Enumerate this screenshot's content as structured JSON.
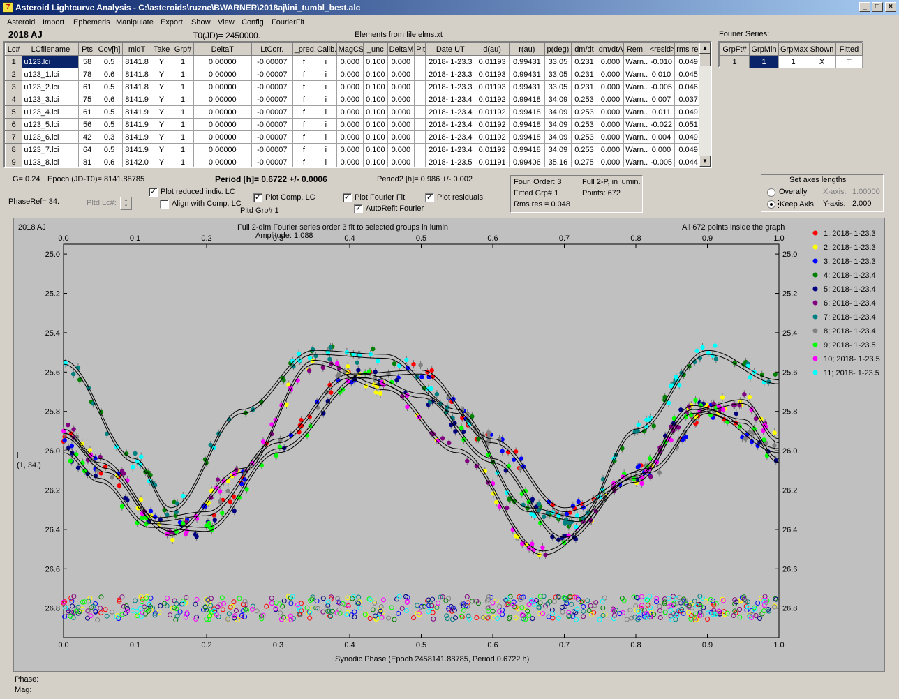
{
  "window": {
    "title": "Asteroid Lightcurve Analysis - C:\\asteroids\\ruzne\\BWARNER\\2018aj\\ini_tumbl_best.alc",
    "icon_name": "app-icon"
  },
  "menu": [
    "Asteroid",
    "Import",
    "Ephemeris",
    "Manipulate",
    "Export",
    "Show",
    "View",
    "Config",
    "FourierFit"
  ],
  "header": {
    "asteroid": "2018 AJ",
    "t0": "T0(JD)= 2450000.",
    "elements": "Elements from file elms.xt",
    "fourier_series_label": "Fourier Series:"
  },
  "lc_table": {
    "columns": [
      "Lc#",
      "LCfilename",
      "Pts",
      "Cov[h]",
      "midT",
      "Take",
      "Grp#",
      "DeltaT",
      "LtCorr.",
      "_pred.",
      "Calib.",
      "MagCS",
      "_unc",
      "DeltaM",
      "Plt",
      "Date UT",
      "d(au)",
      "r(au)",
      "p(deg)",
      "dm/dt",
      "dm/dtA",
      "Rem.",
      "<resid>",
      "rms res"
    ],
    "rows": [
      [
        "1",
        "u123.lci",
        "58",
        "0.5",
        "8141.8",
        "Y",
        "1",
        "0.00000",
        "-0.00007",
        "f",
        "i",
        "0.000",
        "0.100",
        "0.000",
        "",
        "2018- 1-23.3",
        "0.01193",
        "0.99431",
        "33.05",
        "0.231",
        "0.000",
        "Warn...",
        "-0.010",
        "0.049"
      ],
      [
        "2",
        "u123_1.lci",
        "78",
        "0.6",
        "8141.8",
        "Y",
        "1",
        "0.00000",
        "-0.00007",
        "f",
        "i",
        "0.000",
        "0.100",
        "0.000",
        "",
        "2018- 1-23.3",
        "0.01193",
        "0.99431",
        "33.05",
        "0.231",
        "0.000",
        "Warn...",
        "0.010",
        "0.045"
      ],
      [
        "3",
        "u123_2.lci",
        "61",
        "0.5",
        "8141.8",
        "Y",
        "1",
        "0.00000",
        "-0.00007",
        "f",
        "i",
        "0.000",
        "0.100",
        "0.000",
        "",
        "2018- 1-23.3",
        "0.01193",
        "0.99431",
        "33.05",
        "0.231",
        "0.000",
        "Warn...",
        "-0.005",
        "0.046"
      ],
      [
        "4",
        "u123_3.lci",
        "75",
        "0.6",
        "8141.9",
        "Y",
        "1",
        "0.00000",
        "-0.00007",
        "f",
        "i",
        "0.000",
        "0.100",
        "0.000",
        "",
        "2018- 1-23.4",
        "0.01192",
        "0.99418",
        "34.09",
        "0.253",
        "0.000",
        "Warn...",
        "0.007",
        "0.037"
      ],
      [
        "5",
        "u123_4.lci",
        "61",
        "0.5",
        "8141.9",
        "Y",
        "1",
        "0.00000",
        "-0.00007",
        "f",
        "i",
        "0.000",
        "0.100",
        "0.000",
        "",
        "2018- 1-23.4",
        "0.01192",
        "0.99418",
        "34.09",
        "0.253",
        "0.000",
        "Warn...",
        "0.011",
        "0.049"
      ],
      [
        "6",
        "u123_5.lci",
        "56",
        "0.5",
        "8141.9",
        "Y",
        "1",
        "0.00000",
        "-0.00007",
        "f",
        "i",
        "0.000",
        "0.100",
        "0.000",
        "",
        "2018- 1-23.4",
        "0.01192",
        "0.99418",
        "34.09",
        "0.253",
        "0.000",
        "Warn...",
        "-0.022",
        "0.051"
      ],
      [
        "7",
        "u123_6.lci",
        "42",
        "0.3",
        "8141.9",
        "Y",
        "1",
        "0.00000",
        "-0.00007",
        "f",
        "i",
        "0.000",
        "0.100",
        "0.000",
        "",
        "2018- 1-23.4",
        "0.01192",
        "0.99418",
        "34.09",
        "0.253",
        "0.000",
        "Warn...",
        "0.004",
        "0.049"
      ],
      [
        "8",
        "u123_7.lci",
        "64",
        "0.5",
        "8141.9",
        "Y",
        "1",
        "0.00000",
        "-0.00007",
        "f",
        "i",
        "0.000",
        "0.100",
        "0.000",
        "",
        "2018- 1-23.4",
        "0.01192",
        "0.99418",
        "34.09",
        "0.253",
        "0.000",
        "Warn...",
        "0.000",
        "0.049"
      ],
      [
        "9",
        "u123_8.lci",
        "81",
        "0.6",
        "8142.0",
        "Y",
        "1",
        "0.00000",
        "-0.00007",
        "f",
        "i",
        "0.000",
        "0.100",
        "0.000",
        "",
        "2018- 1-23.5",
        "0.01191",
        "0.99406",
        "35.16",
        "0.275",
        "0.000",
        "Warn...",
        "-0.005",
        "0.044"
      ]
    ]
  },
  "fourier_table": {
    "columns": [
      "GrpFt#",
      "GrpMin",
      "GrpMax",
      "Shown",
      "Fitted"
    ],
    "row": [
      "1",
      "1",
      "1",
      "X",
      "T"
    ]
  },
  "info": {
    "g": "G= 0.24",
    "epoch": "Epoch (JD-T0)= 8141.88785",
    "period": "Period [h]= 0.6722 +/- 0.0006",
    "period2": "Period2 [h]= 0.986 +/- 0.002",
    "phaseref": "PhaseRef= 34.",
    "pltd_lc": "Pltd Lc#:",
    "pltd_grp": "Pltd Grp#  1"
  },
  "options": {
    "plot_reduced": "Plot reduced indiv. LC",
    "align": "Align with Comp. LC",
    "plot_comp": "Plot Comp. LC",
    "plot_fourier": "Plot Fourier Fit",
    "plot_residuals": "Plot residuals",
    "autorefit": "AutoRefit Fourier"
  },
  "fitbox": {
    "order": "Four. Order:  3",
    "mode": "Full 2-P, in lumin.",
    "fitted": "Fitted Grp# 1",
    "points": "Points: 672",
    "rms": "Rms res      = 0.048"
  },
  "axes_box": {
    "title": "Set axes lengths",
    "overally": "Overally",
    "keep": "Keep Axis",
    "xaxis_label": "X-axis:",
    "xaxis_value": "1.00000",
    "yaxis_label": "Y-axis:",
    "yaxis_value": "2.000"
  },
  "status": {
    "phase": "Phase:",
    "mag": "Mag:"
  },
  "chart_data": {
    "type": "scatter",
    "corner_label": "2018 AJ",
    "title": "Full 2-dim Fourier series order 3 fit to selected groups in lumin.",
    "subtitle": "Amplitude: 1.088",
    "note": "All 672 points inside the graph",
    "xlabel": "Synodic Phase (Epoch 2458141.88785, Period 0.6722 h)",
    "ylabel": "i",
    "ylabel2": "(1, 34.)",
    "xlim": [
      0.0,
      1.0
    ],
    "ylim": [
      26.95,
      24.95
    ],
    "x_ticks": [
      "0.0",
      "0.1",
      "0.2",
      "0.3",
      "0.4",
      "0.5",
      "0.6",
      "0.7",
      "0.8",
      "0.9",
      "1.0"
    ],
    "y_ticks": [
      "25.0",
      "25.2",
      "25.4",
      "25.6",
      "25.8",
      "26.0",
      "26.2",
      "26.4",
      "26.6",
      "26.8"
    ],
    "residual_baseline": 26.8,
    "series": [
      {
        "name": "1; 2018- 1-23.3",
        "color": "#ff0000",
        "curve": 1
      },
      {
        "name": "2; 2018- 1-23.3",
        "color": "#ffff00",
        "curve": 0
      },
      {
        "name": "3; 2018- 1-23.3",
        "color": "#0000ff",
        "curve": 1
      },
      {
        "name": "4; 2018- 1-23.4",
        "color": "#008000",
        "curve": 2
      },
      {
        "name": "5; 2018- 1-23.4",
        "color": "#000080",
        "curve": 3
      },
      {
        "name": "6; 2018- 1-23.4",
        "color": "#800080",
        "curve": 0
      },
      {
        "name": "7; 2018- 1-23.4",
        "color": "#008080",
        "curve": 2
      },
      {
        "name": "8; 2018- 1-23.4",
        "color": "#808080",
        "curve": 1
      },
      {
        "name": "9; 2018- 1-23.5",
        "color": "#00ff00",
        "curve": 3
      },
      {
        "name": "10; 2018- 1-23.5",
        "color": "#ff00ff",
        "curve": 0
      },
      {
        "name": "11; 2018- 1-23.5",
        "color": "#00ffff",
        "curve": 2
      }
    ],
    "fit_curves": [
      {
        "anchors": [
          [
            0.0,
            25.9
          ],
          [
            0.05,
            26.05
          ],
          [
            0.15,
            26.42
          ],
          [
            0.25,
            26.1
          ],
          [
            0.35,
            25.55
          ],
          [
            0.45,
            25.68
          ],
          [
            0.55,
            26.0
          ],
          [
            0.67,
            26.52
          ],
          [
            0.8,
            26.15
          ],
          [
            0.88,
            25.8
          ],
          [
            0.95,
            25.75
          ],
          [
            1.0,
            25.95
          ]
        ]
      },
      {
        "anchors": [
          [
            0.0,
            25.92
          ],
          [
            0.06,
            26.1
          ],
          [
            0.13,
            26.35
          ],
          [
            0.2,
            26.32
          ],
          [
            0.3,
            25.95
          ],
          [
            0.4,
            25.62
          ],
          [
            0.5,
            25.6
          ],
          [
            0.6,
            25.95
          ],
          [
            0.7,
            26.3
          ],
          [
            0.82,
            26.1
          ],
          [
            0.9,
            25.8
          ],
          [
            1.0,
            26.0
          ]
        ]
      },
      {
        "anchors": [
          [
            0.0,
            25.55
          ],
          [
            0.1,
            26.05
          ],
          [
            0.15,
            26.3
          ],
          [
            0.25,
            25.8
          ],
          [
            0.35,
            25.5
          ],
          [
            0.45,
            25.52
          ],
          [
            0.55,
            25.8
          ],
          [
            0.65,
            26.3
          ],
          [
            0.72,
            26.35
          ],
          [
            0.8,
            25.9
          ],
          [
            0.9,
            25.5
          ],
          [
            1.0,
            25.65
          ]
        ]
      },
      {
        "anchors": [
          [
            0.0,
            26.0
          ],
          [
            0.05,
            26.15
          ],
          [
            0.12,
            26.38
          ],
          [
            0.2,
            26.4
          ],
          [
            0.3,
            26.0
          ],
          [
            0.42,
            25.62
          ],
          [
            0.5,
            25.72
          ],
          [
            0.6,
            26.05
          ],
          [
            0.7,
            26.45
          ],
          [
            0.8,
            26.12
          ],
          [
            0.88,
            25.78
          ],
          [
            0.95,
            25.85
          ],
          [
            1.0,
            26.05
          ]
        ]
      }
    ]
  }
}
